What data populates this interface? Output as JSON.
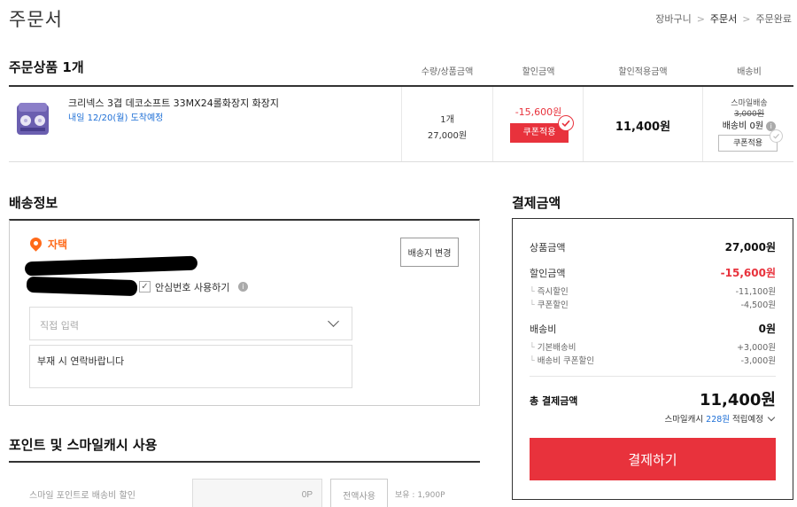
{
  "header": {
    "title": "주문서",
    "breadcrumb": [
      {
        "label": "장바구니"
      },
      {
        "label": "주문서"
      },
      {
        "label": "주문완료"
      }
    ],
    "sep": ">"
  },
  "order": {
    "title": "주문상품 1개",
    "columns": [
      "수량/상품금액",
      "할인금액",
      "할인적용금액",
      "배송비"
    ],
    "item": {
      "name": "크리넥스 3겹 데코소프트 33MX24롤화장지 화장지",
      "delivery": "내일 12/20(월) 도착예정",
      "qty": "1개",
      "price": "27,000원",
      "discount": "-15,600원",
      "coupon_label": "쿠폰적용",
      "final_price": "11,400원",
      "ship_type": "스마일배송",
      "ship_orig": "3,000원",
      "ship_fee": "배송비 0원",
      "ship_coupon_label": "쿠폰적용"
    }
  },
  "shipping": {
    "title": "배송정보",
    "address_label": "자택",
    "change_label": "배송지 변경",
    "safe_number_label": "안심번호 사용하기",
    "memo_placeholder": "직접 입력",
    "memo_value": "부재 시 연락바랍니다"
  },
  "points": {
    "title": "포인트 및 스마일캐시 사용",
    "smile_point_label": "스마일 포인트로 배송비 할인",
    "input_value": "0P",
    "all_label": "전액사용",
    "holding": "보유 : 1,900P"
  },
  "payment": {
    "title": "결제금액",
    "product_amount_label": "상품금액",
    "product_amount": "27,000원",
    "discount_label": "할인금액",
    "discount": "-15,600원",
    "instant_label": "즉시할인",
    "instant": "-11,100원",
    "coupon_label": "쿠폰할인",
    "coupon": "-4,500원",
    "shipping_label": "배송비",
    "shipping": "0원",
    "base_ship_label": "기본배송비",
    "base_ship": "+3,000원",
    "ship_coupon_label": "배송비 쿠폰할인",
    "ship_coupon": "-3,000원",
    "total_label": "총 결제금액",
    "total": "11,400원",
    "cash_prefix": "스마일캐시",
    "cash_amount": "228원",
    "cash_suffix": "적립예정",
    "pay_button": "결제하기"
  },
  "colors": {
    "accent_red": "#e8323c",
    "link_blue": "#1e6fd6",
    "pin_orange": "#ff6a1a"
  }
}
